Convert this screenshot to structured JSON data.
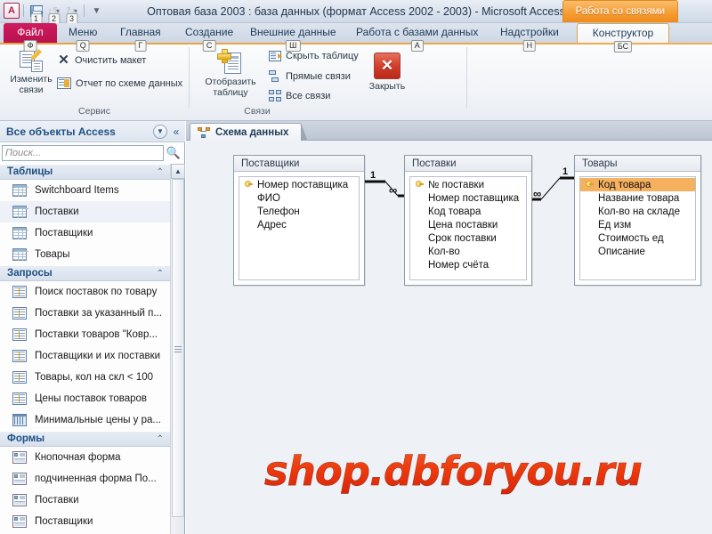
{
  "window": {
    "title": "Оптовая база 2003 : база данных (формат Access 2002 - 2003)  -  Microsoft Access",
    "contextual_tab_banner": "Работа со связями"
  },
  "quick_access": {
    "logo": "A",
    "items": [
      {
        "name": "save-icon",
        "keytip": "1"
      },
      {
        "name": "undo-icon",
        "keytip": "2"
      },
      {
        "name": "redo-icon",
        "keytip": "3"
      }
    ],
    "customize_glyph": "▼"
  },
  "ribbon_tabs": [
    {
      "label": "Файл",
      "keytip": "Ф",
      "active": false,
      "file": true
    },
    {
      "label": "Меню",
      "keytip": "Q",
      "active": false
    },
    {
      "label": "Главная",
      "keytip": "Г",
      "active": false
    },
    {
      "label": "Создание",
      "keytip": "С",
      "active": false
    },
    {
      "label": "Внешние данные",
      "keytip": "Ш",
      "active": false
    },
    {
      "label": "Работа с базами данных",
      "keytip": "А",
      "active": false
    },
    {
      "label": "Надстройки",
      "keytip": "Н",
      "active": false
    },
    {
      "label": "Конструктор",
      "keytip": "БС",
      "active": true
    }
  ],
  "ribbon": {
    "groups": [
      {
        "name": "Сервис",
        "label": "Сервис",
        "big_buttons": [
          {
            "label": "Изменить\nсвязи",
            "label_line1": "Изменить",
            "label_line2": "связи",
            "icon": "edit-relationships-icon"
          }
        ],
        "small_buttons": [
          {
            "label": "Очистить макет",
            "icon": "clear-layout-icon"
          },
          {
            "label": "Отчет по схеме данных",
            "icon": "relationship-report-icon"
          }
        ]
      },
      {
        "name": "Связи",
        "label": "Связи",
        "big_buttons": [
          {
            "label_line1": "Отобразить",
            "label_line2": "таблицу",
            "icon": "show-table-icon"
          }
        ],
        "small_buttons": [
          {
            "label": "Скрыть таблицу",
            "icon": "hide-table-icon"
          },
          {
            "label": "Прямые связи",
            "icon": "direct-relationships-icon"
          },
          {
            "label": "Все связи",
            "icon": "all-relationships-icon"
          }
        ],
        "close_button": {
          "label": "Закрыть",
          "glyph": "✕",
          "icon": "close-relationships-icon"
        }
      }
    ]
  },
  "nav_pane": {
    "title": "Все объекты Access",
    "dropdown_glyph": "▼",
    "collapse_glyph": "«",
    "search": {
      "placeholder": "Поиск...",
      "value": "",
      "icon": "search-icon"
    },
    "groups": [
      {
        "label": "Таблицы",
        "chevron": "⌃",
        "items": [
          {
            "label": "Switchboard Items",
            "icon": "table-icon",
            "selected": false
          },
          {
            "label": "Поставки",
            "icon": "table-icon",
            "selected": true
          },
          {
            "label": "Поставщики",
            "icon": "table-icon",
            "selected": false
          },
          {
            "label": "Товары",
            "icon": "table-icon",
            "selected": false
          }
        ]
      },
      {
        "label": "Запросы",
        "chevron": "⌃",
        "items": [
          {
            "label": "Поиск поставок по товару",
            "icon": "query-icon",
            "selected": false
          },
          {
            "label": "Поставки за указанный п...",
            "icon": "query-icon",
            "selected": false
          },
          {
            "label": "Поставки товаров \"Ковр...",
            "icon": "query-icon",
            "selected": false
          },
          {
            "label": "Поставщики и их поставки",
            "icon": "query-icon",
            "selected": false
          },
          {
            "label": "Товары, кол на скл < 100",
            "icon": "query-icon",
            "selected": false
          },
          {
            "label": "Цены поставок товаров",
            "icon": "query-icon",
            "selected": false
          },
          {
            "label": "Минимальные цены у ра...",
            "icon": "crosstab-query-icon",
            "selected": false
          }
        ]
      },
      {
        "label": "Формы",
        "chevron": "⌃",
        "items": [
          {
            "label": "Кнопочная форма",
            "icon": "form-icon",
            "selected": false
          },
          {
            "label": "подчиненная форма По...",
            "icon": "form-icon",
            "selected": false
          },
          {
            "label": "Поставки",
            "icon": "form-icon",
            "selected": false
          },
          {
            "label": "Поставщики",
            "icon": "form-icon",
            "selected": false
          }
        ]
      }
    ],
    "scrollbar": {
      "up_glyph": "▲"
    }
  },
  "document_tab": {
    "label": "Схема данных",
    "icon": "relationships-diagram-icon"
  },
  "diagram": {
    "tables": [
      {
        "name": "Поставщики",
        "fields": [
          {
            "label": "Номер поставщика",
            "primary_key": true,
            "selected": false
          },
          {
            "label": "ФИО",
            "primary_key": false,
            "selected": false
          },
          {
            "label": "Телефон",
            "primary_key": false,
            "selected": false
          },
          {
            "label": "Адрес",
            "primary_key": false,
            "selected": false
          }
        ]
      },
      {
        "name": "Поставки",
        "fields": [
          {
            "label": "№ поставки",
            "primary_key": true,
            "selected": false
          },
          {
            "label": "Номер поставщика",
            "primary_key": false,
            "selected": false
          },
          {
            "label": "Код товара",
            "primary_key": false,
            "selected": false
          },
          {
            "label": "Цена поставки",
            "primary_key": false,
            "selected": false
          },
          {
            "label": "Срок поставки",
            "primary_key": false,
            "selected": false
          },
          {
            "label": "Кол-во",
            "primary_key": false,
            "selected": false
          },
          {
            "label": "Номер счёта",
            "primary_key": false,
            "selected": false
          }
        ]
      },
      {
        "name": "Товары",
        "fields": [
          {
            "label": "Код товара",
            "primary_key": true,
            "selected": true
          },
          {
            "label": "Название товара",
            "primary_key": false,
            "selected": false
          },
          {
            "label": "Кол-во на складе",
            "primary_key": false,
            "selected": false
          },
          {
            "label": "Ед изм",
            "primary_key": false,
            "selected": false
          },
          {
            "label": "Стоимость ед",
            "primary_key": false,
            "selected": false
          },
          {
            "label": "Описание",
            "primary_key": false,
            "selected": false
          }
        ]
      }
    ],
    "relationships": [
      {
        "from": "Поставщики",
        "to": "Поставки",
        "from_label": "1",
        "to_label": "∞"
      },
      {
        "from": "Поставки",
        "to": "Товары",
        "from_label": "∞",
        "to_label": "1"
      }
    ]
  },
  "watermark": {
    "text": "shop.dbforyou.ru",
    "color": "#ef3a0c"
  }
}
